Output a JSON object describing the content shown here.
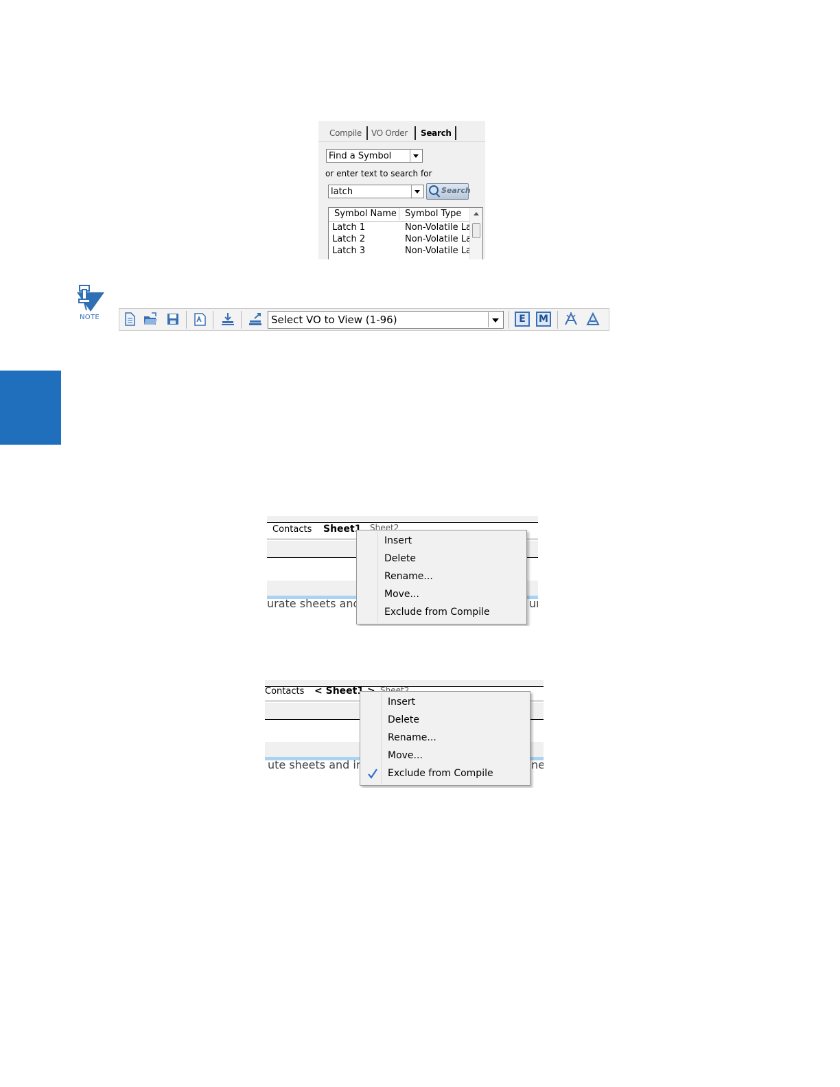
{
  "search_panel": {
    "tabs": [
      {
        "label": "Compile"
      },
      {
        "label": "VO Order"
      },
      {
        "label": "Search",
        "active": true
      }
    ],
    "mode_select": {
      "value": "Find a Symbol"
    },
    "prompt": "or enter text to search for",
    "search_input": {
      "value": "latch"
    },
    "search_button": "Search",
    "columns": [
      "Symbol Name",
      "Symbol Type"
    ],
    "rows": [
      {
        "name": "Latch 1",
        "type": "Non-Volatile La.."
      },
      {
        "name": "Latch 2",
        "type": "Non-Volatile La.."
      },
      {
        "name": "Latch 3",
        "type": "Non-Volatile La.."
      }
    ]
  },
  "note": {
    "label": "NOTE"
  },
  "toolbar": {
    "vo_select": {
      "value": "Select VO to View (1-96)"
    },
    "buttons": {
      "e_label": "E",
      "m_label": "M"
    }
  },
  "context_menu_1": {
    "tabs": [
      "Contacts",
      "Sheet1",
      "Sheet2"
    ],
    "clip_text_left": "urate sheets and",
    "clip_text_right": "un",
    "items": [
      "Insert",
      "Delete",
      "Rename...",
      "Move...",
      "Exclude from Compile"
    ]
  },
  "context_menu_2": {
    "tabs": [
      "Contacts",
      "< Sheet1 >",
      "Sheet2"
    ],
    "clip_text_left": "ute sheets and in",
    "clip_text_right": "ne",
    "items": [
      "Insert",
      "Delete",
      "Rename...",
      "Move...",
      "Exclude from Compile"
    ],
    "checked_item": "Exclude from Compile"
  },
  "colors": {
    "accent_blue": "#1f6fbd",
    "note_blue": "#2f6fb4"
  }
}
